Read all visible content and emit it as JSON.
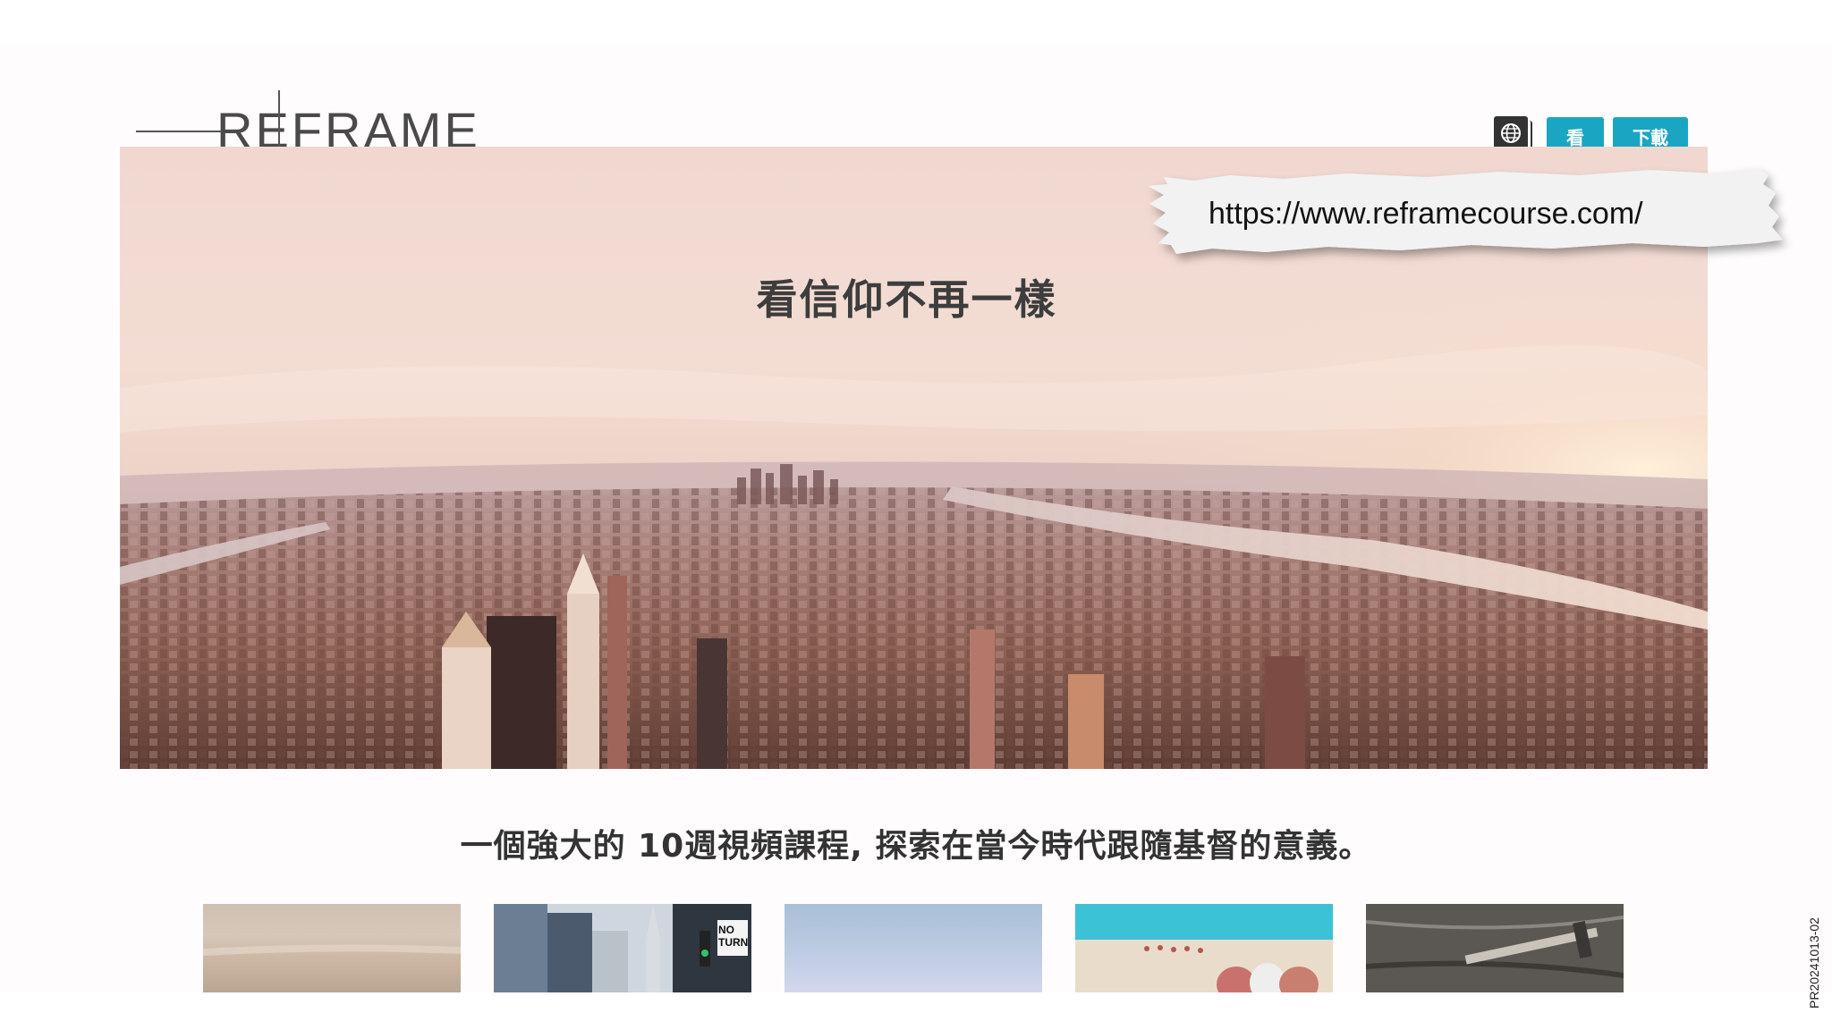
{
  "header": {
    "logo_text": "REFRAME",
    "language_icon": "globe-icon",
    "watch_label": "看",
    "download_label": "下載"
  },
  "hero": {
    "title": "看信仰不再一樣",
    "url": "https://www.reframecourse.com/"
  },
  "subtitle": "一個強大的 10週視頻課程, 探索在當今時代跟隨基督的意義。",
  "thumbnails": [
    {
      "subject": "hazy horizon"
    },
    {
      "subject": "city street with NO TURN sign",
      "sign_text": "NO TURN"
    },
    {
      "subject": "blue sky"
    },
    {
      "subject": "people in desert"
    },
    {
      "subject": "hammer on wood"
    }
  ],
  "side_code": "PR20241013-02",
  "colors": {
    "accent": "#1aa6c3",
    "text_dark": "#333333",
    "background": "#fefcfc"
  }
}
